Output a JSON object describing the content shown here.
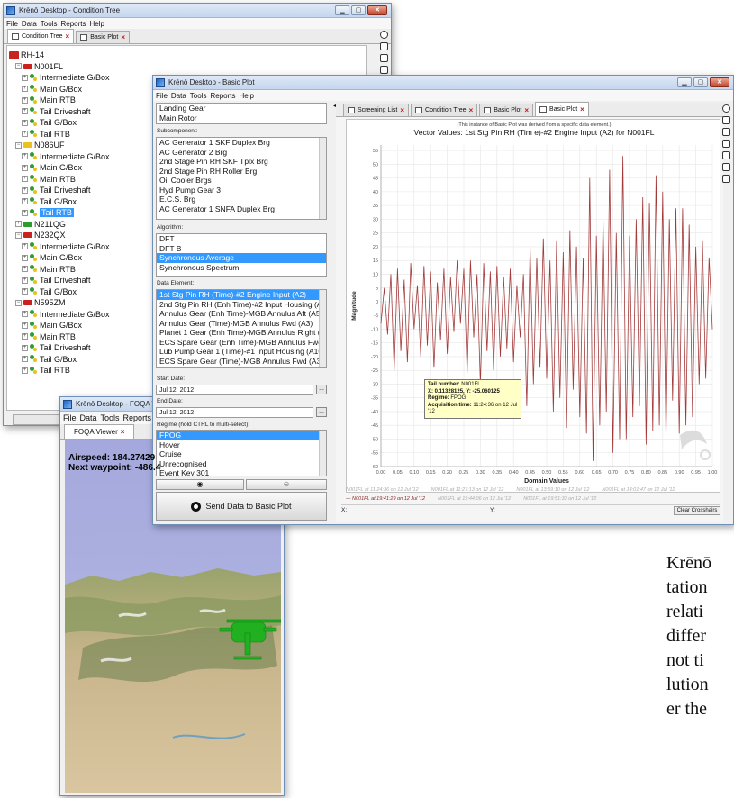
{
  "condition_tree_window": {
    "title": "Krēnō Desktop - Condition Tree",
    "menu": [
      "File",
      "Data",
      "Tools",
      "Reports",
      "Help"
    ],
    "tabs": [
      {
        "label": "Condition Tree",
        "active": true,
        "closable": true
      },
      {
        "label": "Basic Plot",
        "active": false,
        "closable": true
      }
    ],
    "tree": [
      {
        "label": "RH-14",
        "level": 0,
        "kind": "root"
      },
      {
        "label": "N001FL",
        "level": 1,
        "kind": "aircraft",
        "flag": "#c8231f",
        "expander": "⊟"
      },
      {
        "label": "Intermediate G/Box",
        "level": 2,
        "kind": "gear"
      },
      {
        "label": "Main G/Box",
        "level": 2,
        "kind": "gear"
      },
      {
        "label": "Main RTB",
        "level": 2,
        "kind": "gear"
      },
      {
        "label": "Tail Driveshaft",
        "level": 2,
        "kind": "gear"
      },
      {
        "label": "Tail G/Box",
        "level": 2,
        "kind": "gear"
      },
      {
        "label": "Tail RTB",
        "level": 2,
        "kind": "gear"
      },
      {
        "label": "N086UF",
        "level": 1,
        "kind": "aircraft",
        "flag": "#e9c21d",
        "expander": "⊟"
      },
      {
        "label": "Intermediate G/Box",
        "level": 2,
        "kind": "gear"
      },
      {
        "label": "Main G/Box",
        "level": 2,
        "kind": "gear"
      },
      {
        "label": "Main RTB",
        "level": 2,
        "kind": "gear"
      },
      {
        "label": "Tail Driveshaft",
        "level": 2,
        "kind": "gear"
      },
      {
        "label": "Tail G/Box",
        "level": 2,
        "kind": "gear"
      },
      {
        "label": "Tail RTB",
        "level": 2,
        "kind": "gear",
        "selected": true
      },
      {
        "label": "N211QG",
        "level": 1,
        "kind": "aircraft",
        "flag": "#2a9d2a",
        "expander": "⊞"
      },
      {
        "label": "N232QX",
        "level": 1,
        "kind": "aircraft",
        "flag": "#c8231f",
        "expander": "⊟"
      },
      {
        "label": "Intermediate G/Box",
        "level": 2,
        "kind": "gear"
      },
      {
        "label": "Main G/Box",
        "level": 2,
        "kind": "gear"
      },
      {
        "label": "Main RTB",
        "level": 2,
        "kind": "gear"
      },
      {
        "label": "Tail Driveshaft",
        "level": 2,
        "kind": "gear"
      },
      {
        "label": "Tail G/Box",
        "level": 2,
        "kind": "gear"
      },
      {
        "label": "N595ZM",
        "level": 1,
        "kind": "aircraft",
        "flag": "#c8231f",
        "expander": "⊟"
      },
      {
        "label": "Intermediate G/Box",
        "level": 2,
        "kind": "gear"
      },
      {
        "label": "Main G/Box",
        "level": 2,
        "kind": "gear"
      },
      {
        "label": "Main RTB",
        "level": 2,
        "kind": "gear"
      },
      {
        "label": "Tail Driveshaft",
        "level": 2,
        "kind": "gear"
      },
      {
        "label": "Tail G/Box",
        "level": 2,
        "kind": "gear"
      },
      {
        "label": "Tail RTB",
        "level": 2,
        "kind": "gear"
      }
    ]
  },
  "foqa_window": {
    "title": "Krēnō Desktop - FOQA V",
    "menu": [
      "File",
      "Data",
      "Tools",
      "Reports"
    ],
    "tab": "FOQA Viewer",
    "airspeed": "Airspeed: 184.27429",
    "waypoint": "Next waypoint: -486.4"
  },
  "basic_plot_window": {
    "title": "Krēnō Desktop - Basic Plot",
    "menu": [
      "File",
      "Data",
      "Tools",
      "Reports",
      "Help"
    ],
    "component_items": [
      "Landing Gear",
      "Main Rotor"
    ],
    "subcomponent_label": "Subcomponent:",
    "subcomponent_items": [
      "AC Generator 1 SKF Duplex Brg",
      "AC Generator 2 Brg",
      "2nd Stage Pin RH SKF Tplx Brg",
      "2nd Stage Pin RH Roller Brg",
      "Oil Cooler Brgs",
      "Hyd Pump Gear 3",
      "E.C.S. Brg",
      "AC Generator 1 SNFA Duplex Brg"
    ],
    "algorithm_label": "Algorithm:",
    "algorithm_items": [
      "DFT",
      "DFT B",
      "Synchronous Average",
      "Synchronous Spectrum"
    ],
    "algorithm_selected": 2,
    "data_element_label": "Data Element:",
    "data_element_items": [
      "1st Stg Pin RH (Time)-#2 Engine Input (A2)",
      "2nd Stg Pin RH (Enh Time)-#2 Input Housing (A11)",
      "Annulus Gear (Enh Time)-MGB Annulus Aft (A5)",
      "Annulus Gear (Time)-MGB Annulus Fwd (A3)",
      "Planet 1 Gear (Enh Time)-MGB Annulus Right (A4)",
      "ECS Spare Gear (Enh Time)-MGB Annulus Fwd (A3)",
      "Lub Pump Gear 1 (Time)-#1 Input Housing (A10)",
      "ECS Spare Gear (Time)-MGB Annulus Fwd (A3)"
    ],
    "data_element_selected": 0,
    "start_date_label": "Start Date:",
    "start_date": "Jul 12, 2012",
    "end_date_label": "End Date:",
    "end_date": "Jul 12, 2012",
    "date_button": "...",
    "regime_label": "Regime (hold CTRL to multi-select):",
    "regime_items": [
      "FPOG",
      "Hover",
      "Cruise",
      "Unrecognised",
      "Event Key 301"
    ],
    "regime_selected": 0,
    "send_button": "Send Data to Basic Plot",
    "tabs": [
      {
        "label": "Screening List",
        "active": false
      },
      {
        "label": "Condition Tree",
        "active": false
      },
      {
        "label": "Basic Plot",
        "active": false
      },
      {
        "label": "Basic Plot",
        "active": true
      }
    ],
    "plot_note": "(This instance of Basic Plot was derived from a specific data element.)",
    "tooltip": {
      "tail_label": "Tail number:",
      "tail_value": "N001FL",
      "xy_text": "X: 0.11328125, Y: -25.060125",
      "regime_label": "Regime:",
      "regime_value": "FPOG",
      "acq_label": "Acquisition time:",
      "acq_value": "11:24:36 on 12 Jul '12"
    },
    "legend_row1": [
      "N001FL at 11:24:36 on 12 Jul '12",
      "N001FL at 11:27:13 on 12 Jul '12",
      "N001FL at 13:59:10 on 12 Jul '12",
      "N001FL at 14:01:47 on 12 Jul '12"
    ],
    "legend_row2": [
      "— N001FL at 19:41:29 on 12 Jul '12",
      "N001FL at 19:44:06 on 12 Jul '12",
      "N001FL at 19:51:33 on 12 Jul '12"
    ],
    "status_x": "X:",
    "status_y": "Y:",
    "clear_button": "Clear Crosshairs"
  },
  "body_text_lines": [
    "Krēnō",
    "tation",
    "relati",
    "differ",
    "not ti",
    "lution",
    "er the"
  ],
  "chart_data": {
    "type": "line",
    "title": "Vector Values: 1st Stg Pin RH (Tim e)-#2 Engine Input (A2) for N001FL",
    "xlabel": "Domain Values",
    "ylabel": "Magnitude",
    "xlim": [
      0,
      1
    ],
    "ylim": [
      -60,
      57
    ],
    "xticks": [
      "0.00",
      "0.05",
      "0.10",
      "0.15",
      "0.20",
      "0.25",
      "0.30",
      "0.35",
      "0.40",
      "0.45",
      "0.50",
      "0.55",
      "0.60",
      "0.65",
      "0.70",
      "0.75",
      "0.80",
      "0.85",
      "0.90",
      "0.95",
      "1.00"
    ],
    "yticks": [
      55,
      50,
      45,
      40,
      35,
      30,
      25,
      20,
      15,
      10,
      5,
      0,
      -5,
      -10,
      -15,
      -20,
      -25,
      -30,
      -35,
      -40,
      -45,
      -50,
      -55,
      -60
    ],
    "grid": true,
    "line_color": "#a33a3a",
    "series": [
      {
        "x": [
          0.0,
          0.01,
          0.02,
          0.03,
          0.04,
          0.05,
          0.06,
          0.07,
          0.08,
          0.09,
          0.1,
          0.11,
          0.12,
          0.13,
          0.14,
          0.15,
          0.16,
          0.17,
          0.18,
          0.19,
          0.2,
          0.21,
          0.22,
          0.23,
          0.24,
          0.25,
          0.26,
          0.27,
          0.28,
          0.29,
          0.3,
          0.31,
          0.32,
          0.33,
          0.34,
          0.35,
          0.36,
          0.37,
          0.38,
          0.39,
          0.4,
          0.41,
          0.42,
          0.43,
          0.44,
          0.45,
          0.46,
          0.47,
          0.48,
          0.49,
          0.5,
          0.51,
          0.52,
          0.53,
          0.54,
          0.55,
          0.56,
          0.57,
          0.58,
          0.59,
          0.6,
          0.61,
          0.62,
          0.63,
          0.64,
          0.65,
          0.66,
          0.67,
          0.68,
          0.69,
          0.7,
          0.71,
          0.72,
          0.73,
          0.74,
          0.75,
          0.76,
          0.77,
          0.78,
          0.79,
          0.8,
          0.81,
          0.82,
          0.83,
          0.84,
          0.85,
          0.86,
          0.87,
          0.88,
          0.89,
          0.9,
          0.91,
          0.92,
          0.93,
          0.94,
          0.95,
          0.96,
          0.97,
          0.98,
          0.99,
          1.0
        ],
        "values": [
          -8,
          5,
          -12,
          10,
          -25,
          12,
          -18,
          8,
          -22,
          14,
          -10,
          6,
          -20,
          13,
          -16,
          11,
          -24,
          7,
          -14,
          12,
          -19,
          9,
          -11,
          15,
          -8,
          12,
          -26,
          15,
          -13,
          10,
          -30,
          14,
          -18,
          11,
          -25,
          13,
          -20,
          9,
          -17,
          12,
          -22,
          6,
          -13,
          10,
          -38,
          20,
          -30,
          16,
          -24,
          23,
          -28,
          15,
          -40,
          22,
          -35,
          18,
          -46,
          26,
          -32,
          20,
          -42,
          16,
          -48,
          45,
          -58,
          24,
          -45,
          30,
          -40,
          48,
          -55,
          25,
          -50,
          53,
          -50,
          24,
          -42,
          30,
          -38,
          38,
          -52,
          36,
          -47,
          46,
          -45,
          40,
          -50,
          30,
          -36,
          34,
          -48,
          34,
          -45,
          28,
          -42,
          20,
          -30,
          22,
          -28,
          16,
          -10
        ]
      }
    ]
  }
}
